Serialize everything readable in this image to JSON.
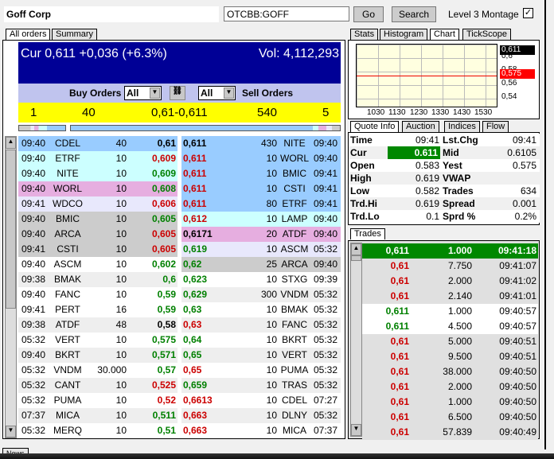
{
  "header": {
    "company": "Goff Corp",
    "symbol": "OTCBB:GOFF",
    "go": "Go",
    "search": "Search",
    "level3": "Level 3 Montage",
    "checked": "✓"
  },
  "left_tabs": [
    "All orders",
    "Summary"
  ],
  "summary": {
    "cur": "Cur 0,611 +0,036 (+6.3%)",
    "vol": "Vol: 4,112,293",
    "buy_label": "Buy Orders",
    "sell_label": "Sell Orders",
    "buy_filter": "All",
    "sell_filter": "All",
    "bid_count": "1",
    "bid_size": "40",
    "spread": "0,61-0,611",
    "ask_size": "540",
    "ask_count": "5"
  },
  "bids": [
    [
      "09:40",
      "CDEL",
      "40",
      "0,61",
      "k",
      "#99ccff"
    ],
    [
      "09:40",
      "ETRF",
      "10",
      "0,609",
      "r",
      "#ccffff"
    ],
    [
      "09:40",
      "NITE",
      "10",
      "0,609",
      "g",
      "#ccffff"
    ],
    [
      "09:40",
      "WORL",
      "10",
      "0,608",
      "g",
      "#e6aee0"
    ],
    [
      "09:41",
      "WDCO",
      "10",
      "0,606",
      "r",
      "#e8e8fc"
    ],
    [
      "09:40",
      "BMIC",
      "10",
      "0,605",
      "g",
      "#cccccc"
    ],
    [
      "09:40",
      "ARCA",
      "10",
      "0,605",
      "r",
      "#cccccc"
    ],
    [
      "09:41",
      "CSTI",
      "10",
      "0,605",
      "r",
      "#cccccc"
    ],
    [
      "09:40",
      "ASCM",
      "10",
      "0,602",
      "g",
      "#ffffff"
    ],
    [
      "09:38",
      "BMAK",
      "10",
      "0,6",
      "g",
      "#eeeeee"
    ],
    [
      "09:40",
      "FANC",
      "10",
      "0,59",
      "g",
      "#ffffff"
    ],
    [
      "09:41",
      "PERT",
      "16",
      "0,59",
      "g",
      "#ffffff"
    ],
    [
      "09:38",
      "ATDF",
      "48",
      "0,58",
      "k",
      "#eeeeee"
    ],
    [
      "05:32",
      "VERT",
      "10",
      "0,575",
      "g",
      "#ffffff"
    ],
    [
      "09:40",
      "BKRT",
      "10",
      "0,571",
      "g",
      "#eeeeee"
    ],
    [
      "05:32",
      "VNDM",
      "30.000",
      "0,57",
      "g",
      "#ffffff"
    ],
    [
      "05:32",
      "CANT",
      "10",
      "0,525",
      "r",
      "#eeeeee"
    ],
    [
      "05:32",
      "PUMA",
      "10",
      "0,52",
      "r",
      "#ffffff"
    ],
    [
      "07:37",
      "MICA",
      "10",
      "0,511",
      "g",
      "#eeeeee"
    ],
    [
      "05:32",
      "MERQ",
      "10",
      "0,51",
      "g",
      "#ffffff"
    ]
  ],
  "asks": [
    [
      "0,611",
      "430",
      "NITE",
      "09:40",
      "k",
      "#99ccff"
    ],
    [
      "0,611",
      "10",
      "WORL",
      "09:40",
      "r",
      "#99ccff"
    ],
    [
      "0,611",
      "10",
      "BMIC",
      "09:41",
      "r",
      "#99ccff"
    ],
    [
      "0,611",
      "10",
      "CSTI",
      "09:41",
      "r",
      "#99ccff"
    ],
    [
      "0,611",
      "80",
      "ETRF",
      "09:41",
      "r",
      "#99ccff"
    ],
    [
      "0,612",
      "10",
      "LAMP",
      "09:40",
      "r",
      "#ccffff"
    ],
    [
      "0,6171",
      "20",
      "ATDF",
      "09:40",
      "k",
      "#e6aee0"
    ],
    [
      "0,619",
      "10",
      "ASCM",
      "05:32",
      "g",
      "#e8e8fc"
    ],
    [
      "0,62",
      "25",
      "ARCA",
      "09:40",
      "g",
      "#cccccc"
    ],
    [
      "0,623",
      "10",
      "STXG",
      "09:39",
      "g",
      "#ffffff"
    ],
    [
      "0,629",
      "300",
      "VNDM",
      "05:32",
      "g",
      "#eeeeee"
    ],
    [
      "0,63",
      "10",
      "BMAK",
      "05:32",
      "g",
      "#ffffff"
    ],
    [
      "0,63",
      "10",
      "FANC",
      "05:32",
      "r",
      "#eeeeee"
    ],
    [
      "0,64",
      "10",
      "BKRT",
      "05:32",
      "g",
      "#ffffff"
    ],
    [
      "0,65",
      "10",
      "VERT",
      "05:32",
      "g",
      "#eeeeee"
    ],
    [
      "0,65",
      "10",
      "PUMA",
      "05:32",
      "r",
      "#ffffff"
    ],
    [
      "0,659",
      "10",
      "TRAS",
      "05:32",
      "g",
      "#eeeeee"
    ],
    [
      "0,6613",
      "10",
      "CDEL",
      "07:27",
      "r",
      "#ffffff"
    ],
    [
      "0,663",
      "10",
      "DLNY",
      "05:32",
      "r",
      "#eeeeee"
    ],
    [
      "0,663",
      "10",
      "MICA",
      "07:37",
      "r",
      "#ffffff"
    ]
  ],
  "right_tabs": [
    "Stats",
    "Histogram",
    "Chart",
    "TickScope"
  ],
  "chart": {
    "x_ticks": [
      "1030",
      "1130",
      "1230",
      "1330",
      "1430",
      "1530"
    ],
    "y_ticks": [
      "0,6",
      "0,58",
      "0,56",
      "0,54"
    ],
    "cur_label": "0,611",
    "yest_label": "0,575",
    "yest_color": "#ff0000"
  },
  "quote_tabs": [
    "Quote Info",
    "Auction",
    "Indices",
    "Flow"
  ],
  "quote": [
    [
      "Time",
      "09:41",
      "Lst.Chg",
      "09:41"
    ],
    [
      "Cur",
      "0.611",
      "Mid",
      "0.6105"
    ],
    [
      "Open",
      "0.583",
      "Yest",
      "0.575"
    ],
    [
      "High",
      "0.619",
      "VWAP",
      ""
    ],
    [
      "Low",
      "0.582",
      "Trades",
      "634"
    ],
    [
      "Trd.Hi",
      "0.619",
      "Spread",
      "0.001"
    ],
    [
      "Trd.Lo",
      "0.1",
      "Sprd %",
      "0.2%"
    ]
  ],
  "trades_tab": "Trades",
  "trades": [
    [
      "0,611",
      "1.000",
      "09:41:18",
      "hl"
    ],
    [
      "0,61",
      "7.750",
      "09:41:07",
      "r"
    ],
    [
      "0,61",
      "2.000",
      "09:41:02",
      "r"
    ],
    [
      "0,61",
      "2.140",
      "09:41:01",
      "r"
    ],
    [
      "0,611",
      "1.000",
      "09:40:57",
      "g"
    ],
    [
      "0,611",
      "4.500",
      "09:40:57",
      "g"
    ],
    [
      "0,61",
      "5.000",
      "09:40:51",
      "r"
    ],
    [
      "0,61",
      "9.500",
      "09:40:51",
      "r"
    ],
    [
      "0,61",
      "38.000",
      "09:40:50",
      "r"
    ],
    [
      "0,61",
      "2.000",
      "09:40:50",
      "r"
    ],
    [
      "0,61",
      "1.000",
      "09:40:50",
      "r"
    ],
    [
      "0,61",
      "6.500",
      "09:40:50",
      "r"
    ],
    [
      "0,61",
      "57.839",
      "09:40:49",
      "r"
    ]
  ],
  "news_tab": "News"
}
